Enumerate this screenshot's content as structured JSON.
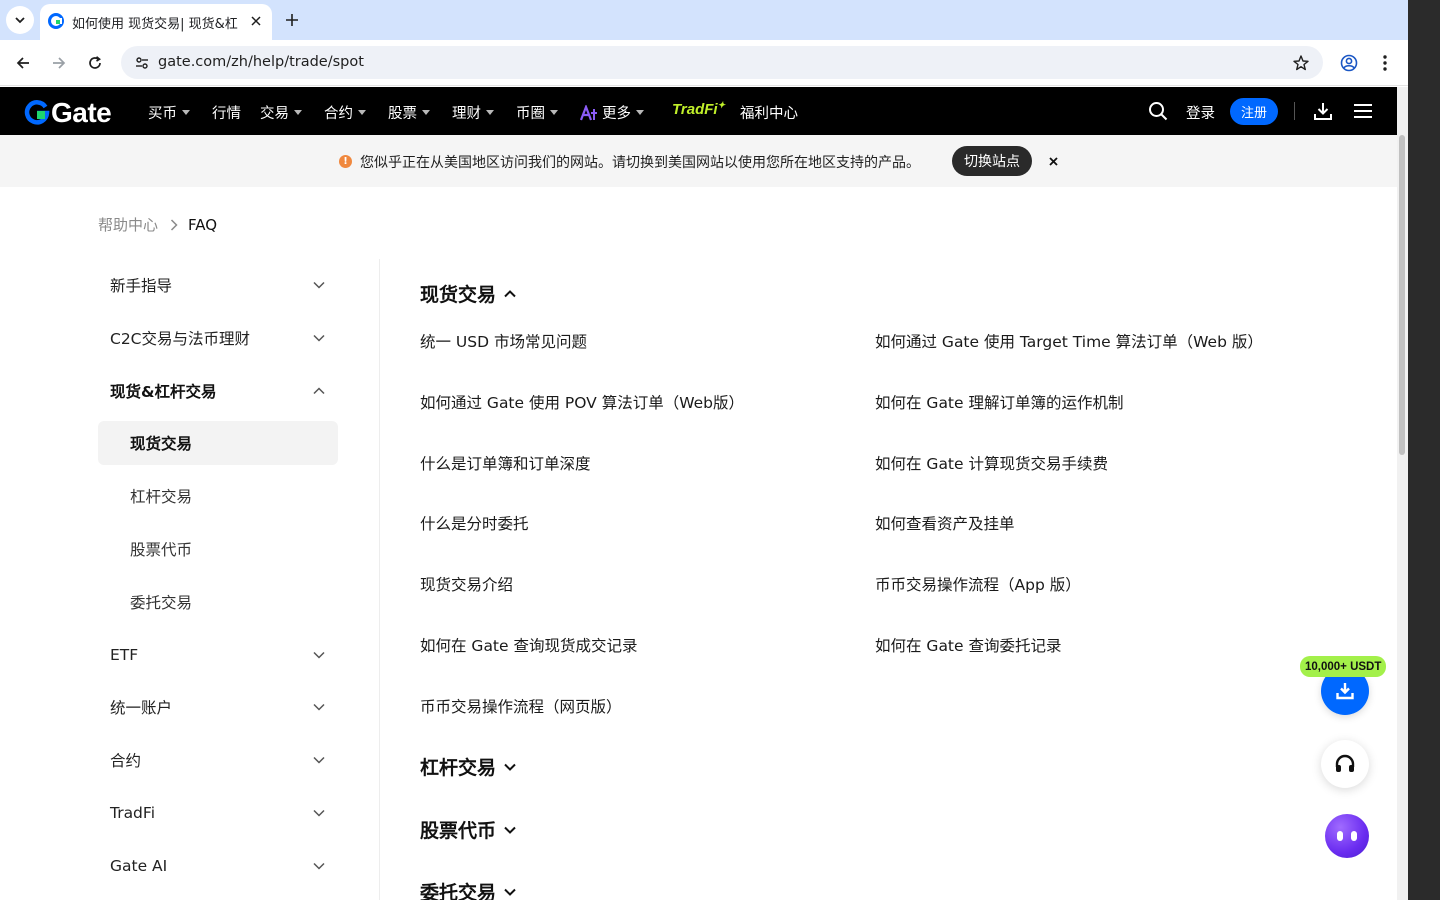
{
  "browser": {
    "tab_title": "如何使用 现货交易| 现货&杠",
    "url": "gate.com/zh/help/trade/spot"
  },
  "nav": {
    "logo_text": "Gate",
    "items": [
      {
        "label": "买币",
        "caret": true
      },
      {
        "label": "行情",
        "caret": false
      },
      {
        "label": "交易",
        "caret": true
      },
      {
        "label": "合约",
        "caret": true
      },
      {
        "label": "股票",
        "caret": true
      },
      {
        "label": "理财",
        "caret": true
      },
      {
        "label": "币圈",
        "caret": true
      },
      {
        "label": "更多",
        "caret": true
      }
    ],
    "tradfi_label": "TradFi",
    "welfare_label": "福利中心",
    "login_label": "登录",
    "register_label": "注册"
  },
  "banner": {
    "message": "您似乎正在从美国地区访问我们的网站。请切换到美国网站以使用您所在地区支持的产品。",
    "switch_label": "切换站点",
    "close_label": "×"
  },
  "breadcrumb": {
    "home": "帮助中心",
    "current": "FAQ"
  },
  "sidebar": {
    "groups": [
      {
        "label": "新手指导",
        "expanded": false
      },
      {
        "label": "C2C交易与法币理财",
        "expanded": false
      },
      {
        "label": "现货&杠杆交易",
        "expanded": true
      },
      {
        "label": "ETF",
        "expanded": false
      },
      {
        "label": "统一账户",
        "expanded": false
      },
      {
        "label": "合约",
        "expanded": false
      },
      {
        "label": "TradFi",
        "expanded": false
      },
      {
        "label": "Gate AI",
        "expanded": false
      }
    ],
    "subitems": [
      {
        "label": "现货交易",
        "active": true
      },
      {
        "label": "杠杆交易",
        "active": false
      },
      {
        "label": "股票代币",
        "active": false
      },
      {
        "label": "委托交易",
        "active": false
      }
    ]
  },
  "main": {
    "sections": [
      {
        "title": "现货交易",
        "expanded": true
      },
      {
        "title": "杠杆交易",
        "expanded": false
      },
      {
        "title": "股票代币",
        "expanded": false
      },
      {
        "title": "委托交易",
        "expanded": false
      }
    ],
    "articles_left": [
      "统一 USD 市场常见问题",
      "如何通过 Gate 使用 POV 算法订单（Web版）",
      "什么是订单簿和订单深度",
      "什么是分时委托",
      "现货交易介绍",
      "如何在 Gate 查询现货成交记录",
      "币币交易操作流程（网页版）"
    ],
    "articles_right": [
      "如何通过 Gate 使用 Target Time 算法订单（Web 版）",
      "如何在 Gate 理解订单簿的运作机制",
      "如何在 Gate 计算现货交易手续费",
      "如何查看资产及挂单",
      "币币交易操作流程（App 版）",
      "如何在 Gate 查询委托记录"
    ]
  },
  "floating": {
    "badge": "10,000+ USDT"
  },
  "colors": {
    "brand_blue": "#0068ff",
    "tradfi_green": "#c1f02a",
    "badge_green": "#a3f04a",
    "nav_bg": "#000000"
  }
}
